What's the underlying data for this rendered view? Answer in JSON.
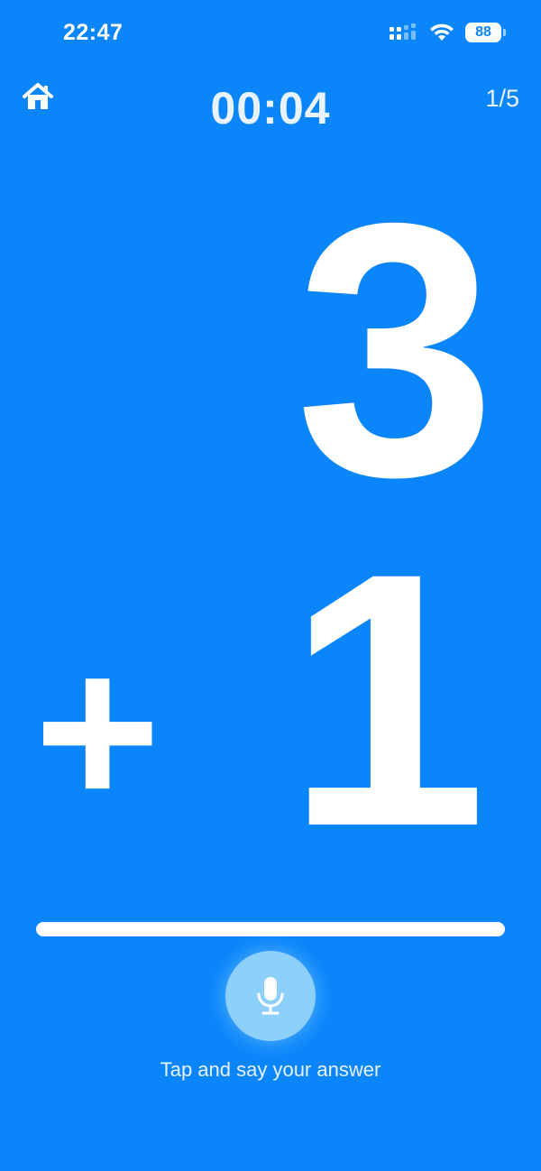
{
  "status_bar": {
    "time": "22:47",
    "battery": "88",
    "signal_icon": "cellular-signal-icon",
    "wifi_icon": "wifi-icon"
  },
  "header": {
    "home_icon": "home-icon",
    "timer": "00:04",
    "progress": "1/5"
  },
  "problem": {
    "top_operand": "3",
    "operator": "+",
    "bottom_operand": "1"
  },
  "answer": {
    "mic_icon": "microphone-icon",
    "hint": "Tap and say your answer"
  },
  "colors": {
    "background": "#0b86fa",
    "mic_button": "#8dd1fb",
    "foreground": "#ffffff"
  }
}
